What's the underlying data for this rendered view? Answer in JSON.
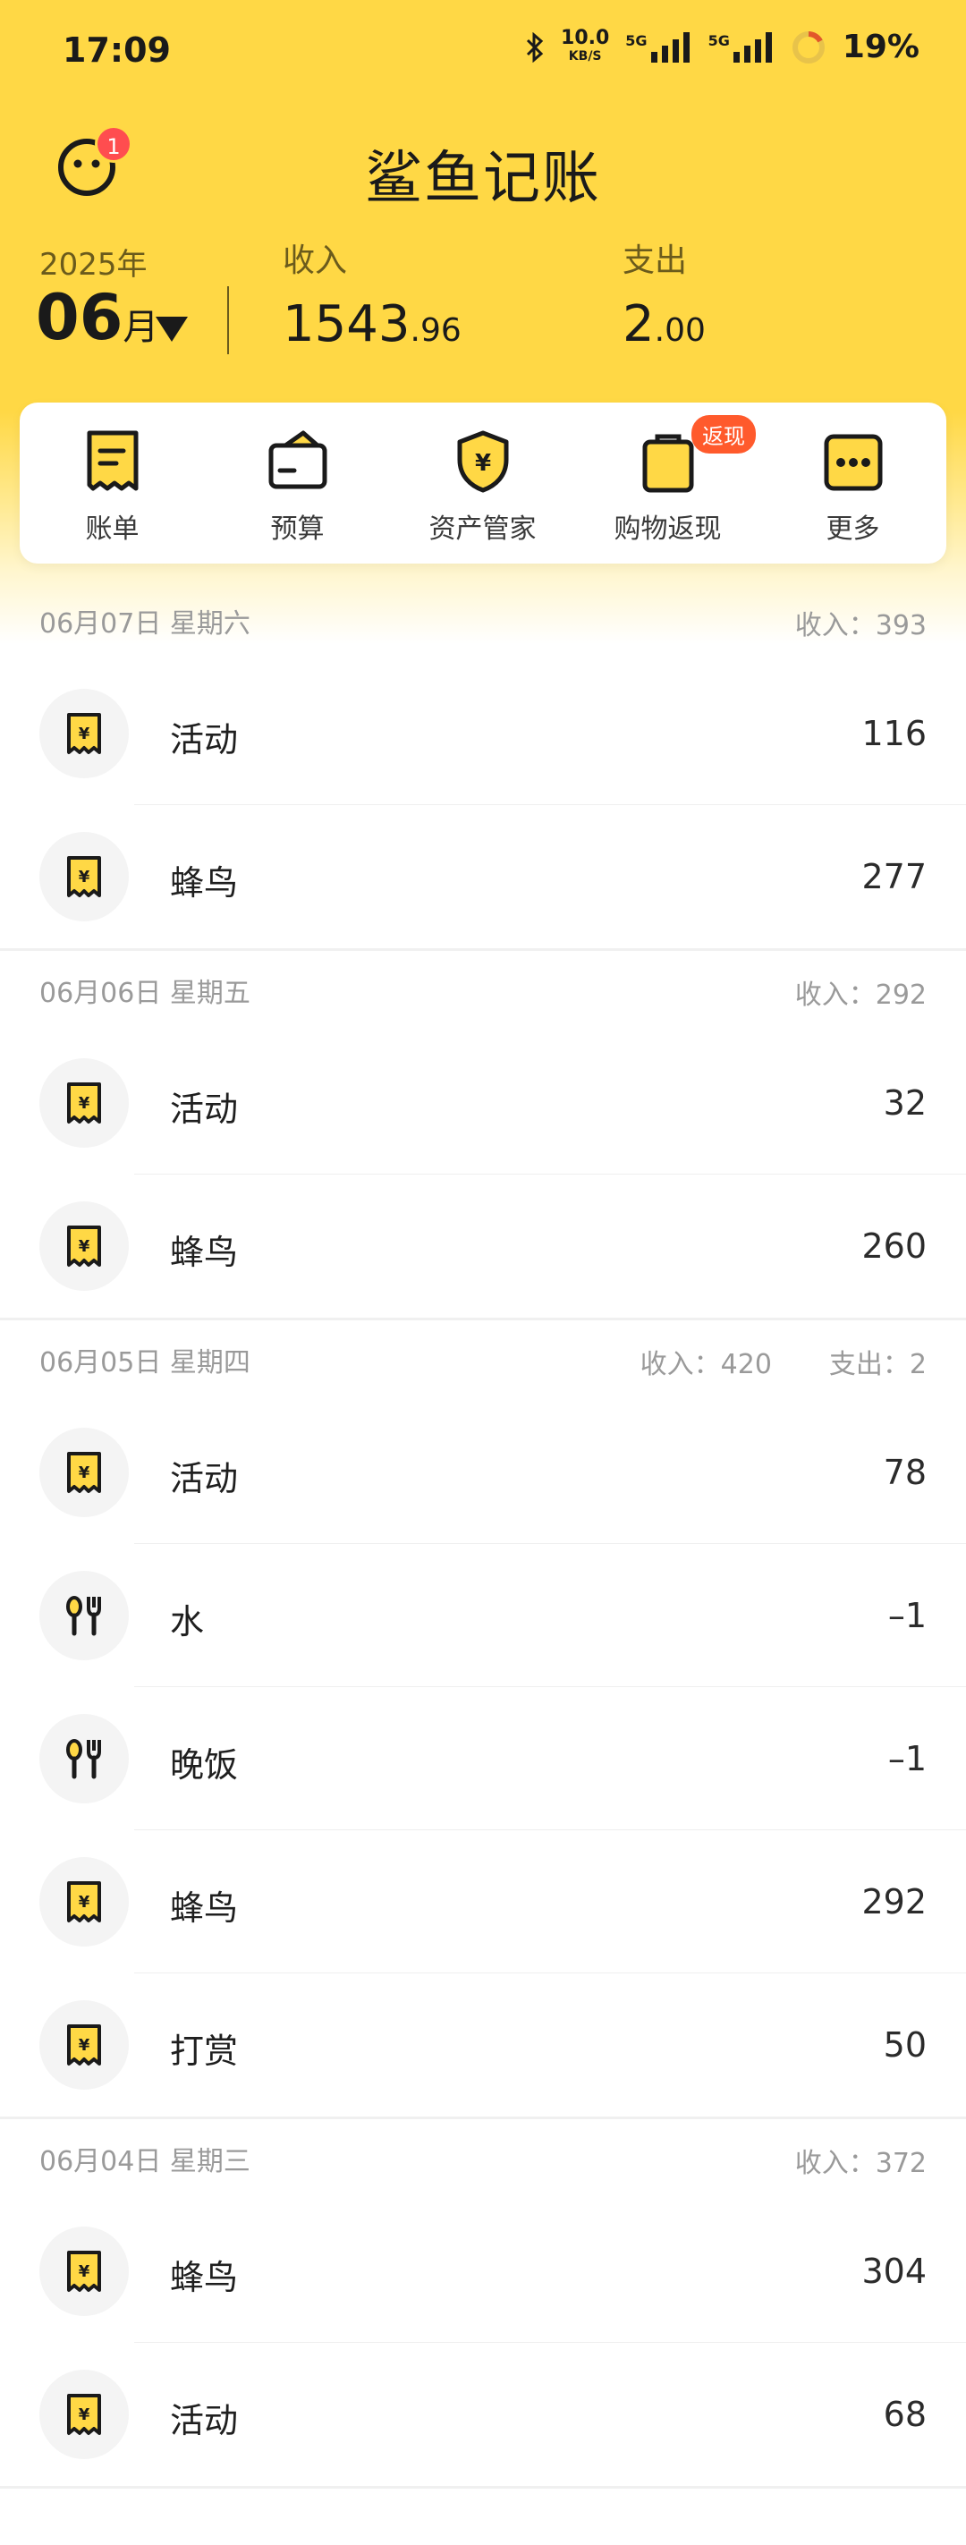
{
  "status_bar": {
    "time": "17:09",
    "speed": "10.0",
    "speed_unit": "KB/S",
    "net1": "5G",
    "net2": "5G",
    "battery": "19%"
  },
  "header": {
    "title": "鲨鱼记账",
    "notification_count": "1"
  },
  "summary": {
    "year": "2025年",
    "month": "06",
    "month_suffix": "月",
    "income_label": "收入",
    "income_int": "1543",
    "income_dec": ".96",
    "expense_label": "支出",
    "expense_int": "2",
    "expense_dec": ".00"
  },
  "menu": {
    "items": [
      {
        "label": "账单",
        "icon": "bill-icon"
      },
      {
        "label": "预算",
        "icon": "budget-wallet-icon"
      },
      {
        "label": "资产管家",
        "icon": "asset-shield-icon"
      },
      {
        "label": "购物返现",
        "icon": "shopping-bag-icon",
        "badge": "返现"
      },
      {
        "label": "更多",
        "icon": "more-icon"
      }
    ]
  },
  "days": [
    {
      "date": "06月07日 星期六",
      "income": "收入：393",
      "expense": "",
      "entries": [
        {
          "name": "活动",
          "amount": "116",
          "icon": "receipt-yen-icon"
        },
        {
          "name": "蜂鸟",
          "amount": "277",
          "icon": "receipt-yen-icon"
        }
      ]
    },
    {
      "date": "06月06日 星期五",
      "income": "收入：292",
      "expense": "",
      "entries": [
        {
          "name": "活动",
          "amount": "32",
          "icon": "receipt-yen-icon"
        },
        {
          "name": "蜂鸟",
          "amount": "260",
          "icon": "receipt-yen-icon"
        }
      ]
    },
    {
      "date": "06月05日 星期四",
      "income": "收入：420",
      "expense": "支出：2",
      "entries": [
        {
          "name": "活动",
          "amount": "78",
          "icon": "receipt-yen-icon"
        },
        {
          "name": "水",
          "amount": "–1",
          "icon": "food-icon"
        },
        {
          "name": "晚饭",
          "amount": "–1",
          "icon": "food-icon"
        },
        {
          "name": "蜂鸟",
          "amount": "292",
          "icon": "receipt-yen-icon"
        },
        {
          "name": "打赏",
          "amount": "50",
          "icon": "receipt-yen-icon"
        }
      ]
    },
    {
      "date": "06月04日 星期三",
      "income": "收入：372",
      "expense": "",
      "entries": [
        {
          "name": "蜂鸟",
          "amount": "304",
          "icon": "receipt-yen-icon"
        },
        {
          "name": "活动",
          "amount": "68",
          "icon": "receipt-yen-icon"
        }
      ]
    }
  ],
  "colors": {
    "brand_yellow": "#ffd845",
    "badge_red": "#ff4d4f",
    "cashback_orange": "#ff5a2c"
  }
}
